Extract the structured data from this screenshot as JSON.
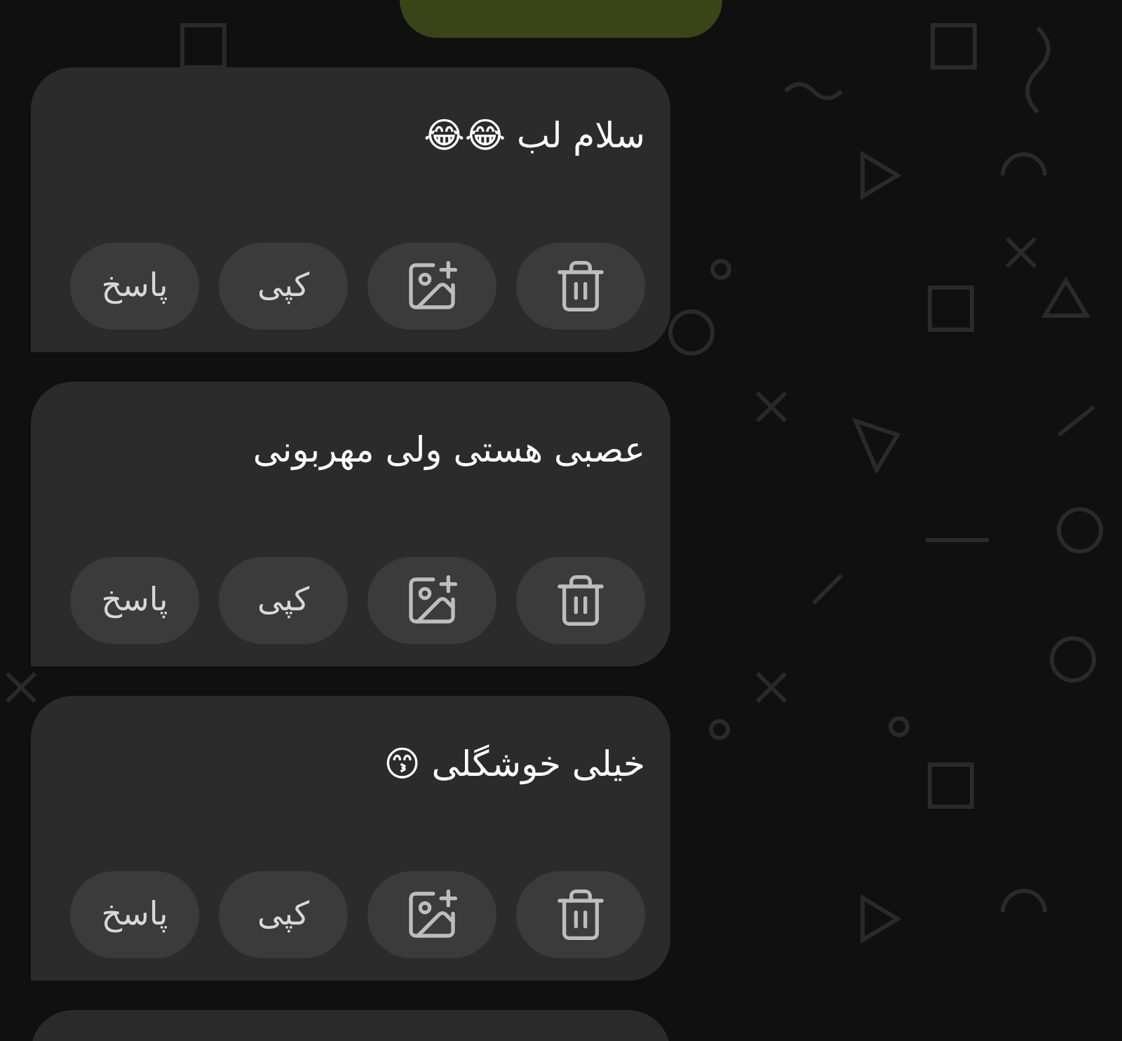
{
  "messages": [
    {
      "kind": "outgoing_cut"
    },
    {
      "kind": "incoming",
      "text": "سلام لب 😂😂",
      "actions": [
        {
          "kind": "delete"
        },
        {
          "kind": "image"
        },
        {
          "kind": "copy",
          "label": "کپی"
        },
        {
          "kind": "reply",
          "label": "پاسخ"
        }
      ]
    },
    {
      "kind": "incoming",
      "text": "عصبی هستی ولی مهربونی",
      "actions": [
        {
          "kind": "delete"
        },
        {
          "kind": "image"
        },
        {
          "kind": "copy",
          "label": "کپی"
        },
        {
          "kind": "reply",
          "label": "پاسخ"
        }
      ]
    },
    {
      "kind": "incoming",
      "text": "خیلی خوشگلی 😙",
      "actions": [
        {
          "kind": "delete"
        },
        {
          "kind": "image"
        },
        {
          "kind": "copy",
          "label": "کپی"
        },
        {
          "kind": "reply",
          "label": "پاسخ"
        }
      ]
    },
    {
      "kind": "incoming_cut"
    }
  ]
}
